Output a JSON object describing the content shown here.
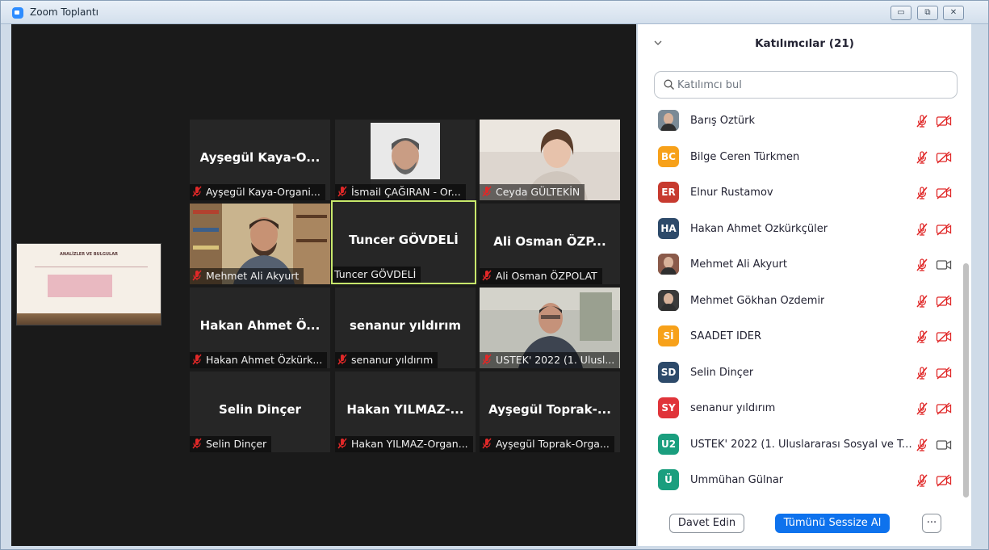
{
  "window": {
    "title": "Zoom Toplantı",
    "minimize": "▭",
    "restore": "⧉",
    "close": "✕"
  },
  "shared_screen": {
    "slide_title": "ANALİZLER VE BULGULAR"
  },
  "tiles": [
    {
      "big_name": "Ayşegül  Kaya-O...",
      "label": "Ayşegül Kaya-Organi...",
      "muted": true
    },
    {
      "big_name": "",
      "label": "İsmail ÇAĞIRAN - Or...",
      "muted": true
    },
    {
      "big_name": "",
      "label": "Ceyda GÜLTEKİN",
      "muted": true
    },
    {
      "big_name": "",
      "label": "Mehmet Ali Akyurt",
      "muted": true
    },
    {
      "big_name": "Tuncer GÖVDELİ",
      "label": "Tuncer GÖVDELİ",
      "muted": false
    },
    {
      "big_name": "Ali Osman  ÖZP...",
      "label": "Ali Osman ÖZPOLAT",
      "muted": true
    },
    {
      "big_name": "Hakan Ahmet  Ö...",
      "label": "Hakan Ahmet Özkürk...",
      "muted": true
    },
    {
      "big_name": "senanur yıldırım",
      "label": "senanur yıldırım",
      "muted": true
    },
    {
      "big_name": "",
      "label": "USTEK' 2022 (1. Ulusl...",
      "muted": true
    },
    {
      "big_name": "Selin Dinçer",
      "label": "Selin Dinçer",
      "muted": true
    },
    {
      "big_name": "Hakan  YILMAZ-...",
      "label": "Hakan YILMAZ-Organ...",
      "muted": true
    },
    {
      "big_name": "Ayşegül  Toprak-...",
      "label": "Ayşegül Toprak-Orga...",
      "muted": true
    }
  ],
  "panel": {
    "title": "Katılımcılar (21)",
    "search_placeholder": "Katılımcı bul",
    "participants": [
      {
        "initials": "",
        "name": "Barış Öztürk",
        "avatar_color": "#7a8a96",
        "photo": true,
        "video_off": true
      },
      {
        "initials": "BC",
        "name": "Bilge Ceren Türkmen",
        "avatar_color": "#f7a11a",
        "photo": false,
        "video_off": true
      },
      {
        "initials": "ER",
        "name": "Elnur Rustamov",
        "avatar_color": "#c73a2f",
        "photo": false,
        "video_off": true
      },
      {
        "initials": "HA",
        "name": "Hakan Ahmet Özkürkçüler",
        "avatar_color": "#2d4a6a",
        "photo": false,
        "video_off": true
      },
      {
        "initials": "",
        "name": "Mehmet Ali Akyurt",
        "avatar_color": "#8a5a4a",
        "photo": true,
        "video_off": false
      },
      {
        "initials": "",
        "name": "Mehmet Gökhan Özdemir",
        "avatar_color": "#3a3a3a",
        "photo": true,
        "video_off": true
      },
      {
        "initials": "Sİ",
        "name": "SAADET İDER",
        "avatar_color": "#f7a11a",
        "photo": false,
        "video_off": true
      },
      {
        "initials": "SD",
        "name": "Selin Dinçer",
        "avatar_color": "#2d4a6a",
        "photo": false,
        "video_off": true
      },
      {
        "initials": "SY",
        "name": "senanur yıldırım",
        "avatar_color": "#e0343a",
        "photo": false,
        "video_off": true
      },
      {
        "initials": "U2",
        "name": "USTEK' 2022 (1. Uluslararası Sosyal ve Tek...",
        "avatar_color": "#1a9e7e",
        "photo": false,
        "video_off": false
      },
      {
        "initials": "Ü",
        "name": "Ümmühan Gülnar",
        "avatar_color": "#1a9e7e",
        "photo": false,
        "video_off": true
      }
    ],
    "invite_label": "Davet Edin",
    "mute_all_label": "Tümünü Sessize Al",
    "more_label": "···"
  },
  "colors": {
    "accent": "#0e72ed",
    "muted_icon": "#e02828",
    "active_speaker": "#c7e86b"
  }
}
